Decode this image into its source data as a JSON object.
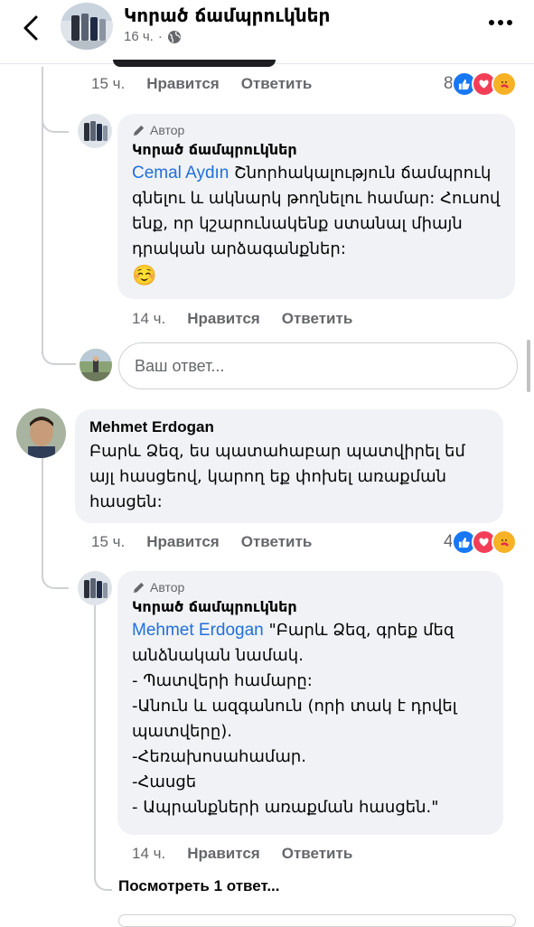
{
  "header": {
    "page_name": "Կորած ճամպրուկներ",
    "time": "16 ч.",
    "privacy_icon": "globe-icon"
  },
  "top_comment": {
    "time": "15 ч.",
    "like_label": "Нравится",
    "reply_label": "Ответить",
    "reaction_count": "8"
  },
  "reply1": {
    "author_badge": "Автор",
    "name": "Կորած ճամպրուկներ",
    "mention": "Cemal Aydın",
    "text": " Շնորհակալություն ճամպրուկ գնելու և ակնարկ թողնելու համար: Հուսով ենք, որ կշարունակենք ստանալ միայն դրական արձագանքներ:",
    "emoji": "☺️",
    "time": "14 ч.",
    "like_label": "Нравится",
    "reply_label": "Ответить"
  },
  "reply_input": {
    "placeholder": "Ваш ответ..."
  },
  "comment2": {
    "name": "Mehmet Erdogan",
    "text": "Բարև Ձեզ, ես պատահաբար պատվիրել եմ այլ հասցեով, կարող եք փոխել առաքման հասցեն:",
    "time": "15 ч.",
    "like_label": "Нравится",
    "reply_label": "Ответить",
    "reaction_count": "4"
  },
  "reply2": {
    "author_badge": "Автор",
    "name": "Կորած ճամպրուկներ",
    "mention": "Mehmet Erdogan",
    "lines": [
      " \"Բարև Ձեզ, գրեք մեզ անձնական նամակ.",
      "- Պատվերի համարը:",
      "-Անուն և ազգանուն (որի տակ է դրվել պատվերը).",
      "-Հեռախոսահամար.",
      "-Հասցե",
      "- Ապրանքների առաքման հասցեն.\""
    ],
    "time": "14 ч.",
    "like_label": "Нравится",
    "reply_label": "Ответить"
  },
  "view_more": "Посмотреть 1 ответ...",
  "colors": {
    "link": "#216fdb",
    "bubble": "#f0f2f5",
    "secondary_text": "#65676b",
    "like_blue": "#1877f2",
    "love_red": "#f33e58",
    "care_yellow": "#f7b125"
  }
}
